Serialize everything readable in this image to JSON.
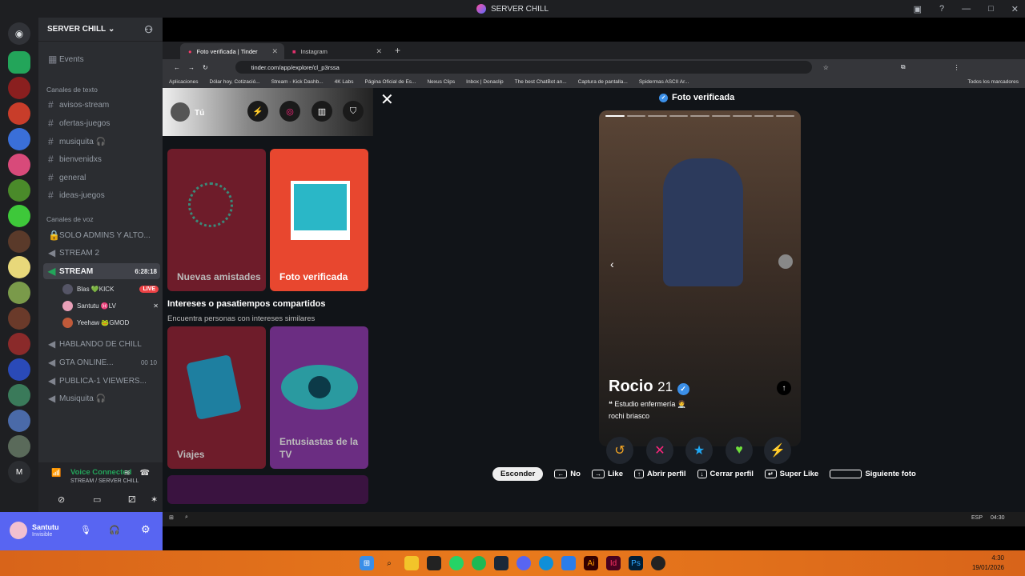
{
  "window": {
    "title": "SERVER CHILL"
  },
  "discord": {
    "server_name": "SERVER CHILL",
    "events_label": "Events",
    "text_category": "Canales de texto",
    "text_channels": [
      "avisos-stream",
      "ofertas-juegos",
      "musiquita 🎧",
      "bienvenidxs",
      "general",
      "ideas-juegos"
    ],
    "voice_category": "Canales de voz",
    "voice_channels": [
      {
        "name": "SOLO ADMINS Y ALTO...",
        "extra": ""
      },
      {
        "name": "STREAM 2",
        "extra": ""
      },
      {
        "name": "STREAM",
        "extra": "6:28:18"
      }
    ],
    "stream_users": [
      {
        "name": "Blas 💚KICK",
        "badge": "LIVE"
      },
      {
        "name": "Santutu ♓LV",
        "badge": ""
      },
      {
        "name": "Yeehaw 🐸GMOD",
        "badge": ""
      }
    ],
    "more_voice": [
      {
        "name": "HABLANDO DE CHILL",
        "extra": ""
      },
      {
        "name": "GTA ONLINE...",
        "extra": "00 10"
      },
      {
        "name": "PUBLICA-1 VIEWERS...",
        "extra": ""
      },
      {
        "name": "Musiquita 🎧",
        "extra": ""
      }
    ],
    "voice_connected": "Voice Connected",
    "voice_location": "STREAM / SERVER CHILL",
    "user_name": "Santutu",
    "user_status": "Invisible"
  },
  "browser": {
    "tabs": [
      {
        "label": "Foto verificada | Tinder",
        "active": true
      },
      {
        "label": "Instagram",
        "active": false
      }
    ],
    "url": "tinder.com/app/explore/cl_p3rssa",
    "bookmarks": [
      "Aplicaciones",
      "Dólar hoy, Cotizació...",
      "Stream - Kick Dashb...",
      "4K Labs",
      "Página Oficial de Es...",
      "Nexus Clips",
      "Inbox | Donaclip",
      "The best ChatBot an...",
      "Captura de pantalla...",
      "Spidermas ASCII Ar..."
    ],
    "bookmarks_all": "Todos los marcadores"
  },
  "tinder": {
    "me_label": "Tú",
    "cards_top": [
      {
        "label": "Nuevas amistades",
        "color": "#6e1c2a"
      },
      {
        "label": "Foto verificada",
        "color": "#e8472f"
      }
    ],
    "section_title": "Intereses o pasatiempos compartidos",
    "section_sub": "Encuentra personas con intereses similares",
    "cards_bottom": [
      {
        "label": "Viajes",
        "color": "#6e1c2a"
      },
      {
        "label": "Entusiastas de la TV",
        "color": "#6b2d82"
      }
    ],
    "header_title": "Foto verificada",
    "profile_name": "Rocio",
    "profile_age": "21",
    "profile_bio": "❝ Estudio enfermería 🧑‍⚕️",
    "profile_handle": "rochi briasco",
    "actions": [
      "↺",
      "✕",
      "★",
      "♥",
      "⚡"
    ],
    "action_colors": [
      "#f5a623",
      "#fd267d",
      "#1fa8f5",
      "#6fe03c",
      "#a044ff"
    ],
    "hints": {
      "hide": "Esconder",
      "no": "No",
      "like": "Like",
      "open": "Abrir perfil",
      "close": "Cerrar perfil",
      "super": "Super Like",
      "next": "Siguiente foto"
    }
  },
  "system": {
    "time": "4:30",
    "date": "19/01/2026",
    "inner_time": "04:30",
    "lang": "ESP"
  }
}
